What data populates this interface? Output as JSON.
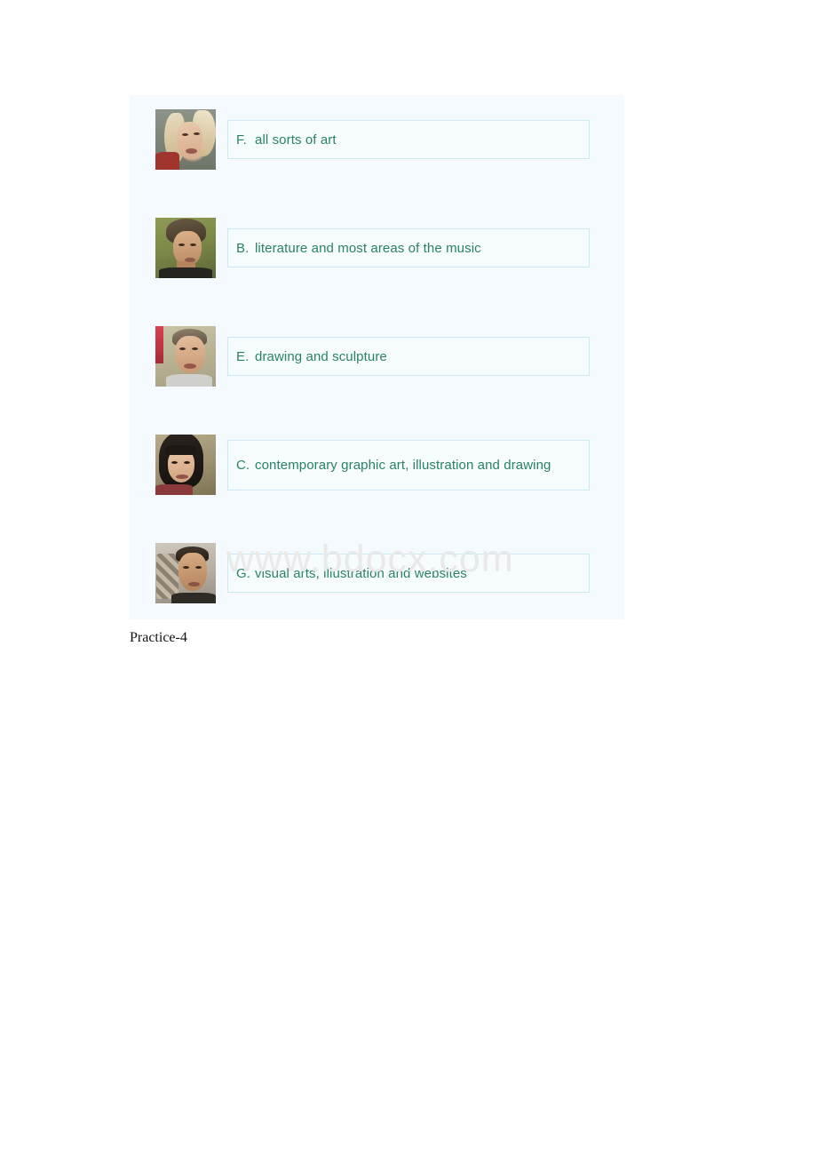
{
  "document": {
    "caption": "Practice-4",
    "watermark": "www.bdocx.com",
    "panel_background": "#f4fafd",
    "option_text_color": "#2a8265",
    "option_border_color": "#cde8f5"
  },
  "exercise": {
    "rows": [
      {
        "photo": "blonde-woman-photo",
        "letter": "F.",
        "text": "all sorts of art",
        "justified": false
      },
      {
        "photo": "young-man-curly-hair-photo",
        "letter": "B.",
        "text": "literature and most areas of the music",
        "justified": false
      },
      {
        "photo": "middle-aged-man-photo",
        "letter": "E.",
        "text": "drawing and sculpture",
        "justified": false
      },
      {
        "photo": "dark-haired-woman-photo",
        "letter": "C.",
        "text": "contemporary graphic art, illustration and drawing",
        "justified": true
      },
      {
        "photo": "short-haired-man-photo",
        "letter": "G.",
        "text": "visual arts, illustration and websites",
        "justified": false
      }
    ]
  }
}
